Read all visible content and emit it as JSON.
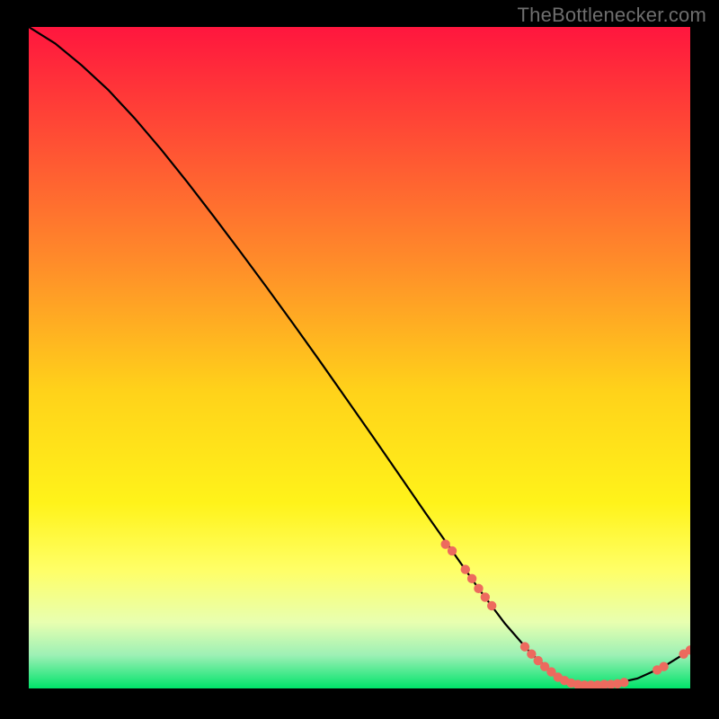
{
  "watermark": "TheBottlenecker.com",
  "chart_data": {
    "type": "line",
    "title": "",
    "xlabel": "",
    "ylabel": "",
    "xlim": [
      0,
      100
    ],
    "ylim": [
      0,
      100
    ],
    "gradient_stops": [
      {
        "offset": 0.0,
        "color": "#ff163e"
      },
      {
        "offset": 0.35,
        "color": "#ff8a2a"
      },
      {
        "offset": 0.55,
        "color": "#ffd21a"
      },
      {
        "offset": 0.72,
        "color": "#fff31a"
      },
      {
        "offset": 0.82,
        "color": "#ffff66"
      },
      {
        "offset": 0.9,
        "color": "#e8ffb0"
      },
      {
        "offset": 0.95,
        "color": "#9cf0b5"
      },
      {
        "offset": 1.0,
        "color": "#00e36a"
      }
    ],
    "curve": {
      "x": [
        0,
        4,
        8,
        12,
        16,
        20,
        24,
        28,
        32,
        36,
        40,
        44,
        48,
        52,
        56,
        60,
        64,
        68,
        72,
        76,
        80,
        84,
        88,
        92,
        96,
        100
      ],
      "y": [
        100,
        97.5,
        94.2,
        90.5,
        86.2,
        81.5,
        76.5,
        71.3,
        66.0,
        60.6,
        55.1,
        49.5,
        43.8,
        38.1,
        32.3,
        26.5,
        20.8,
        15.1,
        9.8,
        5.2,
        1.7,
        0.5,
        0.6,
        1.5,
        3.3,
        5.8
      ]
    },
    "points": {
      "x": [
        63,
        64,
        66,
        67,
        68,
        69,
        70,
        75,
        76,
        77,
        78,
        79,
        80,
        81,
        82,
        83,
        84,
        85,
        86,
        87,
        88,
        89,
        90,
        95,
        96,
        99,
        100
      ],
      "y": [
        21.8,
        20.8,
        18.0,
        16.6,
        15.1,
        13.8,
        12.5,
        6.3,
        5.2,
        4.2,
        3.3,
        2.5,
        1.7,
        1.2,
        0.8,
        0.6,
        0.5,
        0.5,
        0.5,
        0.6,
        0.6,
        0.7,
        0.9,
        2.8,
        3.3,
        5.2,
        5.8
      ]
    },
    "point_color": "#ed6a5e",
    "point_radius_px": 5.2
  }
}
